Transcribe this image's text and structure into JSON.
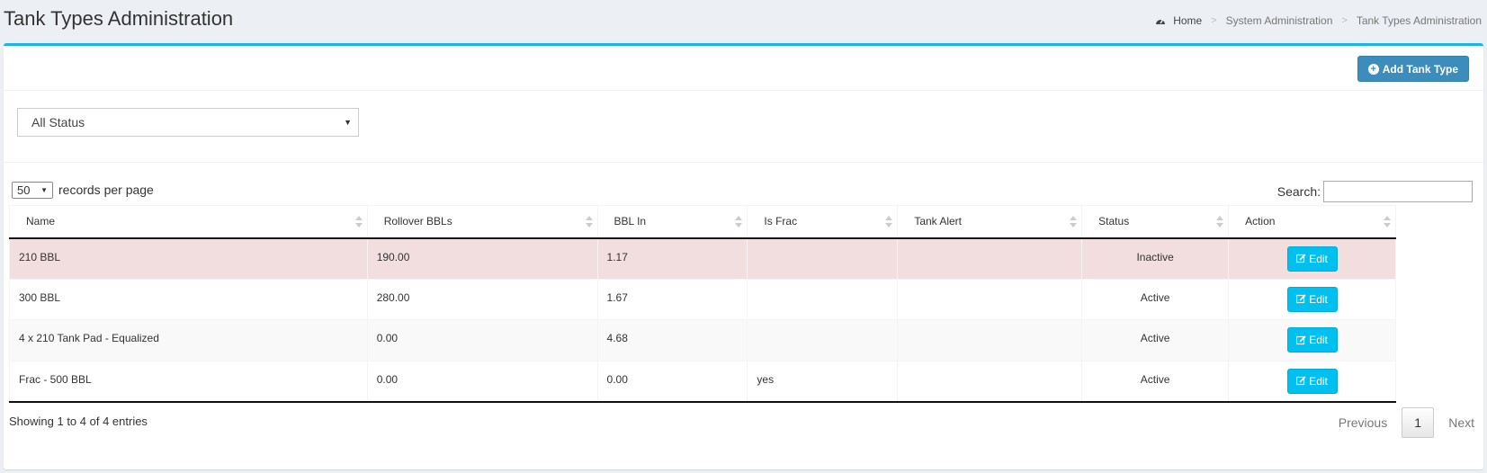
{
  "page": {
    "title": "Tank Types Administration"
  },
  "breadcrumb": {
    "home": "Home",
    "items": [
      "System Administration",
      "Tank Types Administration"
    ]
  },
  "toolbar": {
    "add_label": "Add Tank Type"
  },
  "filter": {
    "status_value": "All Status"
  },
  "datatable": {
    "length_value": "50",
    "length_label": "records per page",
    "search_label": "Search:",
    "search_value": "",
    "columns": [
      "Name",
      "Rollover BBLs",
      "BBL In",
      "Is Frac",
      "Tank Alert",
      "Status",
      "Action"
    ],
    "rows": [
      {
        "name": "210 BBL",
        "rollover": "190.00",
        "bbl_in": "1.17",
        "is_frac": "",
        "tank_alert": "",
        "status": "Inactive",
        "action": "Edit"
      },
      {
        "name": "300 BBL",
        "rollover": "280.00",
        "bbl_in": "1.67",
        "is_frac": "",
        "tank_alert": "",
        "status": "Active",
        "action": "Edit"
      },
      {
        "name": "4 x 210 Tank Pad - Equalized",
        "rollover": "0.00",
        "bbl_in": "4.68",
        "is_frac": "",
        "tank_alert": "",
        "status": "Active",
        "action": "Edit"
      },
      {
        "name": "Frac - 500 BBL",
        "rollover": "0.00",
        "bbl_in": "0.00",
        "is_frac": "yes",
        "tank_alert": "",
        "status": "Active",
        "action": "Edit"
      }
    ],
    "info": "Showing 1 to 4 of 4 entries",
    "pagination": {
      "previous": "Previous",
      "current": "1",
      "next": "Next"
    }
  },
  "colors": {
    "accent": "#1bb4e6",
    "primary_button": "#3c8dbc",
    "edit_button": "#00c0ef",
    "inactive_row": "#f2dede"
  },
  "icons": [
    "dashboard-icon",
    "plus-circle-icon",
    "chevron-down-icon",
    "sort-icon",
    "edit-icon"
  ]
}
